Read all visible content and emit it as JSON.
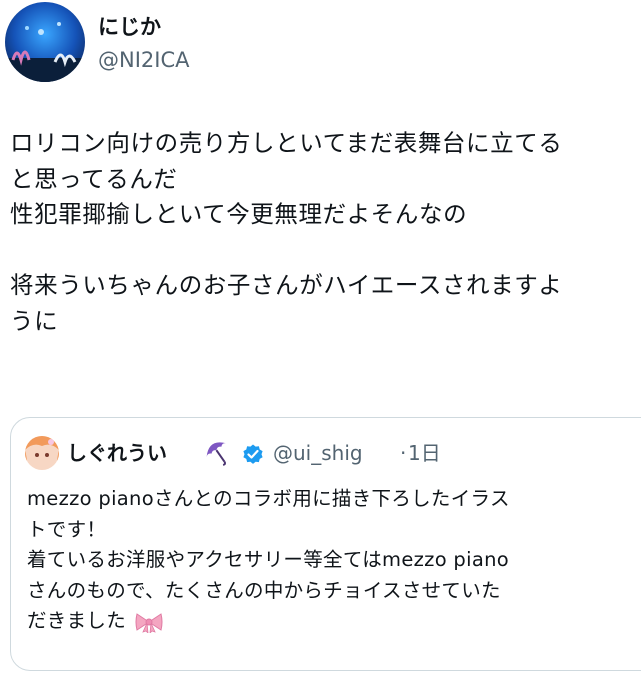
{
  "tweet": {
    "author": {
      "display_name": "にじか",
      "handle": "@NI2ICA",
      "avatar_icon": "aquarium-avatar-icon"
    },
    "body_lines": [
      "ロリコン向けの売り方しといてまだ表舞台に立てる",
      "と思ってるんだ",
      "性犯罪揶揄しといて今更無理だよそんなの",
      "",
      "将来ういちゃんのお子さんがハイエースされますよ",
      "うに"
    ]
  },
  "quoted_tweet": {
    "display_name": "しぐれうい",
    "name_emoji": "umbrella-icon",
    "verified_icon": "verified-badge-icon",
    "handle": "@ui_shig",
    "separator": "·",
    "time": "1日",
    "text_lines": [
      "mezzo pianoさんとのコラボ用に描き下ろしたイラス",
      "トです！",
      "着ているお洋服やアクセサリー等全てはmezzo piano",
      "さんのもので、たくさんの中からチョイスさせていた",
      "だきました"
    ],
    "trailing_emoji": "ribbon-icon",
    "colors": {
      "verified": "#1d9bf0",
      "ribbon": "#f4a6c1",
      "umbrella": "#7e57c2"
    }
  }
}
